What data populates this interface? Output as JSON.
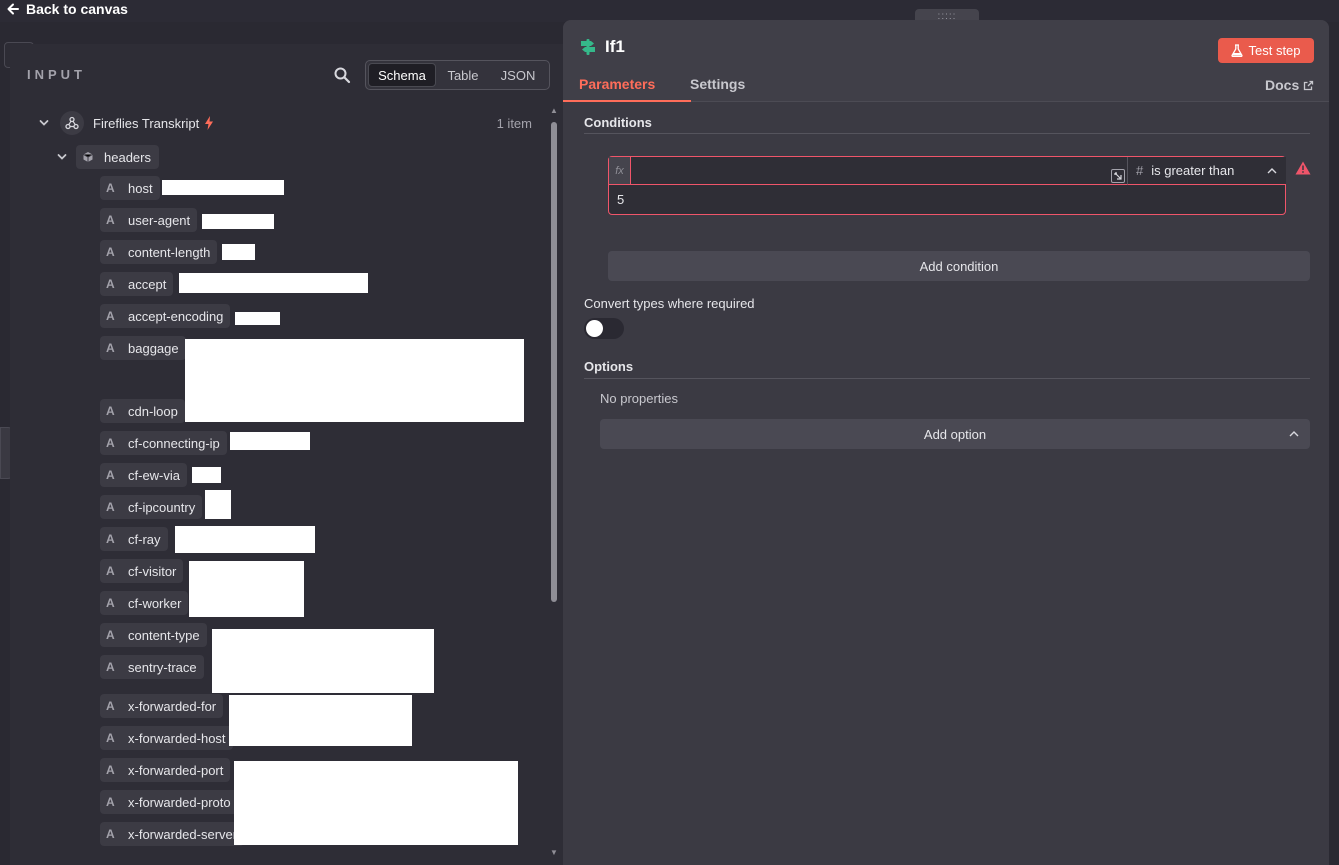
{
  "topbar": {
    "back_label": "Back to canvas",
    "drag_handle": ":::::"
  },
  "input_panel": {
    "title": "INPUT",
    "view_modes": [
      "Schema",
      "Table",
      "JSON"
    ],
    "active_view": "Schema",
    "node": {
      "name": "Fireflies Transkript",
      "item_count": "1 item"
    },
    "object": {
      "name": "headers"
    },
    "fields": [
      {
        "type": "A",
        "name": "host"
      },
      {
        "type": "A",
        "name": "user-agent"
      },
      {
        "type": "A",
        "name": "content-length"
      },
      {
        "type": "A",
        "name": "accept"
      },
      {
        "type": "A",
        "name": "accept-encoding"
      },
      {
        "type": "A",
        "name": "baggage"
      },
      {
        "type": "A",
        "name": "cdn-loop"
      },
      {
        "type": "A",
        "name": "cf-connecting-ip"
      },
      {
        "type": "A",
        "name": "cf-ew-via"
      },
      {
        "type": "A",
        "name": "cf-ipcountry"
      },
      {
        "type": "A",
        "name": "cf-ray"
      },
      {
        "type": "A",
        "name": "cf-visitor"
      },
      {
        "type": "A",
        "name": "cf-worker"
      },
      {
        "type": "A",
        "name": "content-type"
      },
      {
        "type": "A",
        "name": "sentry-trace"
      },
      {
        "type": "A",
        "name": "x-forwarded-for"
      },
      {
        "type": "A",
        "name": "x-forwarded-host"
      },
      {
        "type": "A",
        "name": "x-forwarded-port"
      },
      {
        "type": "A",
        "name": "x-forwarded-proto"
      },
      {
        "type": "A",
        "name": "x-forwarded-server"
      }
    ]
  },
  "node_panel": {
    "title": "If1",
    "test_button": "Test step",
    "tabs": [
      "Parameters",
      "Settings"
    ],
    "active_tab": "Parameters",
    "docs_label": "Docs",
    "conditions": {
      "label": "Conditions",
      "fx": "fx",
      "left_value": "",
      "operator_type_icon": "#",
      "operator": "is greater than",
      "right_value": "5",
      "add_label": "Add condition"
    },
    "convert_types": {
      "label": "Convert types where required",
      "enabled": false
    },
    "options": {
      "label": "Options",
      "empty_text": "No properties",
      "add_label": "Add option"
    }
  },
  "colors": {
    "accent": "#ff6d5a",
    "test_button": "#ea5b4c",
    "error_border": "#f0556a",
    "node_icon": "#35b88a"
  }
}
